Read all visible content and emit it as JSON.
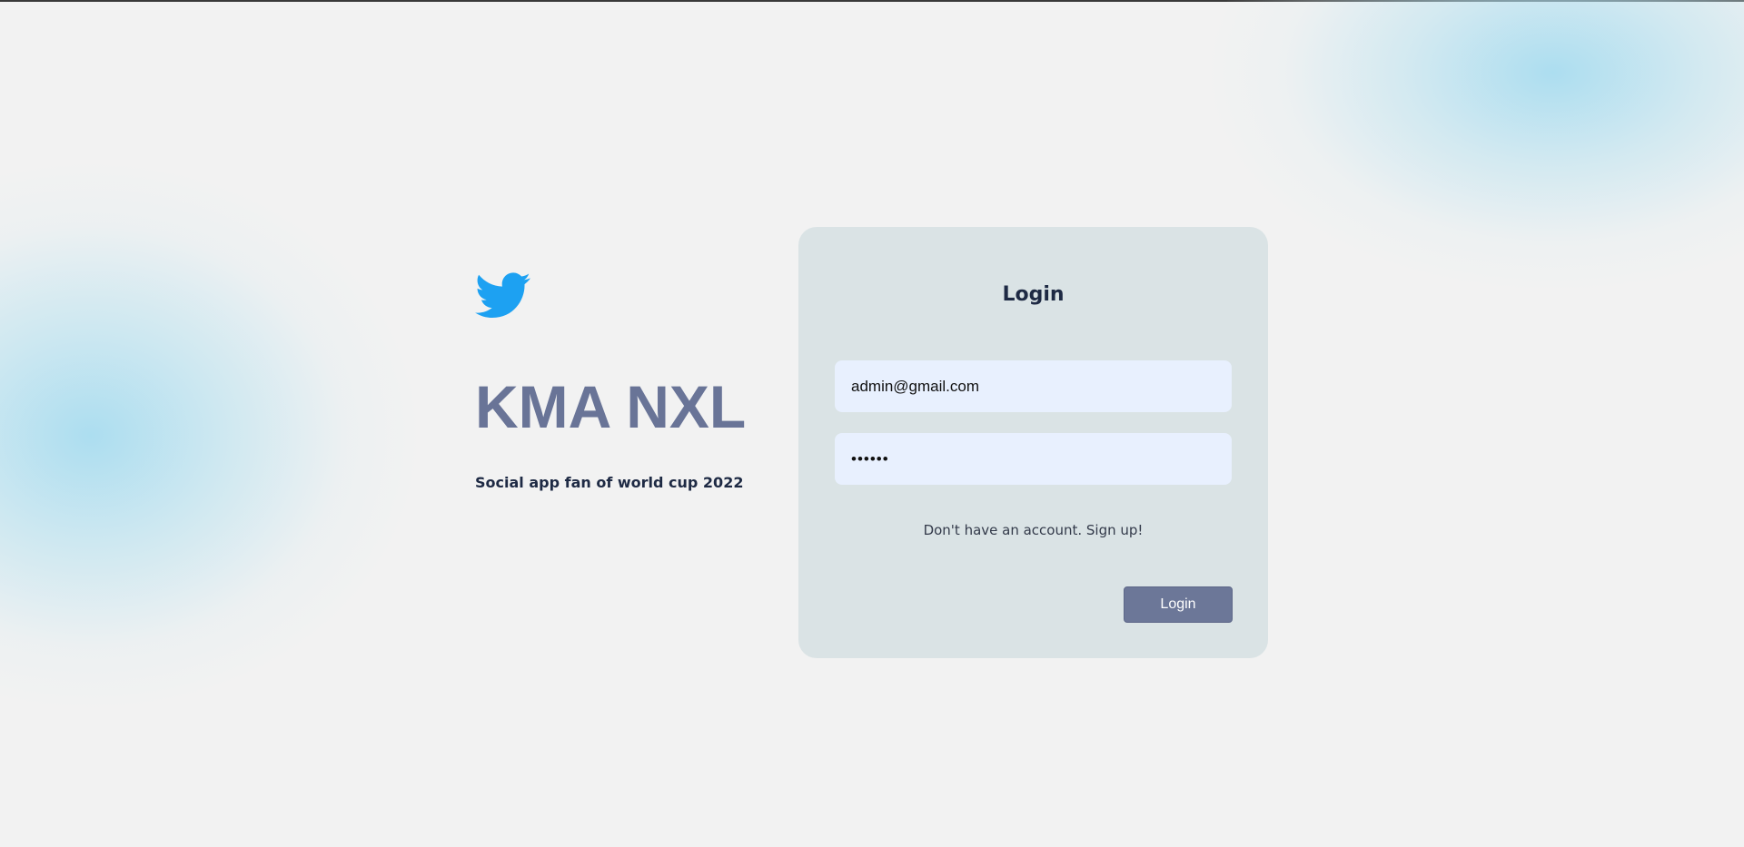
{
  "brand": {
    "icon": "twitter-bird-icon",
    "title": "KMA NXL",
    "tagline": "Social app fan of world cup 2022"
  },
  "login_card": {
    "title": "Login",
    "email_value": "admin@gmail.com",
    "password_value": "••••••",
    "signup_text": "Don't have an account. Sign up!",
    "login_button_label": "Login"
  },
  "colors": {
    "brand_title": "#697497",
    "card_background": "#dae3e5",
    "input_background": "#e8f0fe",
    "button_background": "#6c7798",
    "bird_icon": "#1da1f2"
  }
}
